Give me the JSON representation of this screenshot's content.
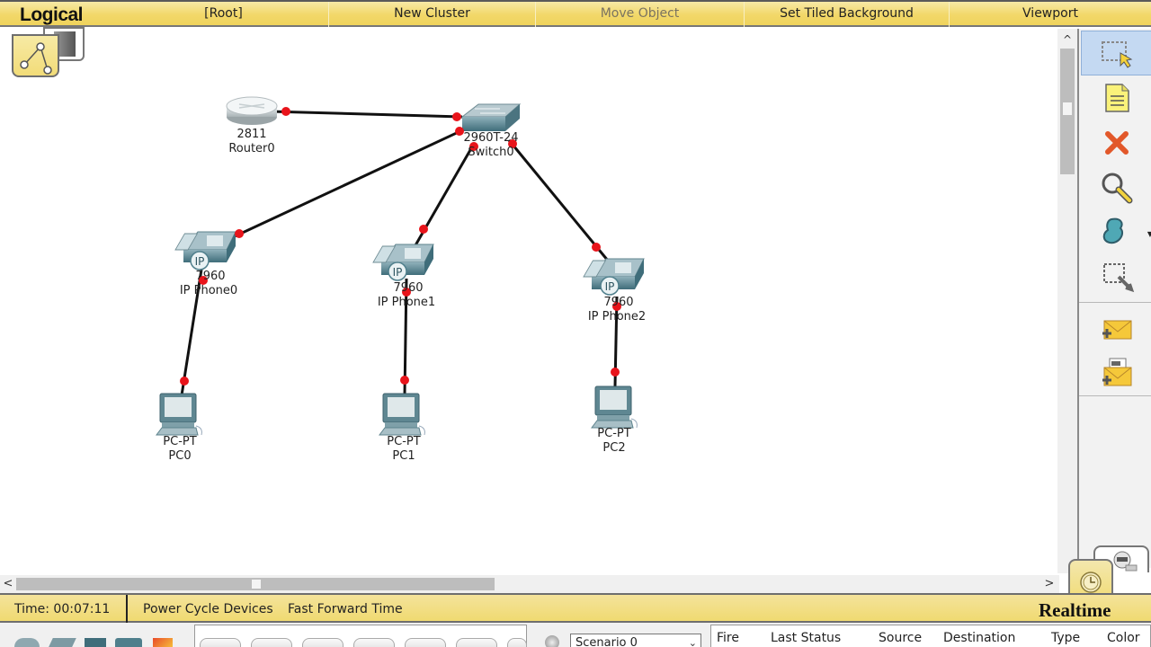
{
  "topbar": {
    "mode_title": "Logical",
    "items": [
      {
        "label": "[Root]",
        "enabled": true
      },
      {
        "label": "New Cluster",
        "enabled": true
      },
      {
        "label": "Move Object",
        "enabled": false
      },
      {
        "label": "Set Tiled Background",
        "enabled": true
      },
      {
        "label": "Viewport",
        "enabled": true
      }
    ]
  },
  "topology": {
    "devices": [
      {
        "id": "router0",
        "model": "2811",
        "name": "Router0",
        "type": "router"
      },
      {
        "id": "switch0",
        "model": "2960T-24",
        "name": "Switch0",
        "type": "switch"
      },
      {
        "id": "phone0",
        "model": "7960",
        "name": "IP Phone0",
        "type": "ip-phone",
        "badge": "IP"
      },
      {
        "id": "phone1",
        "model": "7960",
        "name": "IP Phone1",
        "type": "ip-phone",
        "badge": "IP"
      },
      {
        "id": "phone2",
        "model": "7960",
        "name": "IP Phone2",
        "type": "ip-phone",
        "badge": "IP"
      },
      {
        "id": "pc0",
        "model": "PC-PT",
        "name": "PC0",
        "type": "pc"
      },
      {
        "id": "pc1",
        "model": "PC-PT",
        "name": "PC1",
        "type": "pc"
      },
      {
        "id": "pc2",
        "model": "PC-PT",
        "name": "PC2",
        "type": "pc"
      }
    ],
    "links": [
      {
        "from": "router0",
        "to": "switch0",
        "status": "down"
      },
      {
        "from": "switch0",
        "to": "phone0",
        "status": "down"
      },
      {
        "from": "switch0",
        "to": "phone1",
        "status": "down"
      },
      {
        "from": "switch0",
        "to": "phone2",
        "status": "down"
      },
      {
        "from": "phone0",
        "to": "pc0",
        "status": "down"
      },
      {
        "from": "phone1",
        "to": "pc1",
        "status": "down"
      },
      {
        "from": "phone2",
        "to": "pc2",
        "status": "down"
      }
    ],
    "link_status_color": "#e8141b"
  },
  "right_toolbar": {
    "tools": [
      {
        "name": "select",
        "active": true
      },
      {
        "name": "place-note",
        "active": false
      },
      {
        "name": "delete",
        "active": false
      },
      {
        "name": "inspect",
        "active": false
      },
      {
        "name": "draw-shape",
        "active": false
      },
      {
        "name": "resize-shape",
        "active": false
      },
      {
        "name": "add-simple-pdu",
        "active": false
      },
      {
        "name": "add-complex-pdu",
        "active": false
      }
    ]
  },
  "timebar": {
    "time": "Time: 00:07:11",
    "power_cycle_label": "Power Cycle Devices",
    "fast_forward_label": "Fast Forward Time",
    "mode_label": "Realtime"
  },
  "bottom": {
    "scenario": "Scenario 0",
    "pdu_columns": [
      "Fire",
      "Last Status",
      "Source",
      "Destination",
      "Type",
      "Color"
    ]
  },
  "scroll": {
    "up": "^",
    "left": "<",
    "right": ">"
  },
  "colors": {
    "accent_yellow": "#f2d86a",
    "link_red": "#e8141b",
    "device_teal": "#4f7f8c"
  }
}
